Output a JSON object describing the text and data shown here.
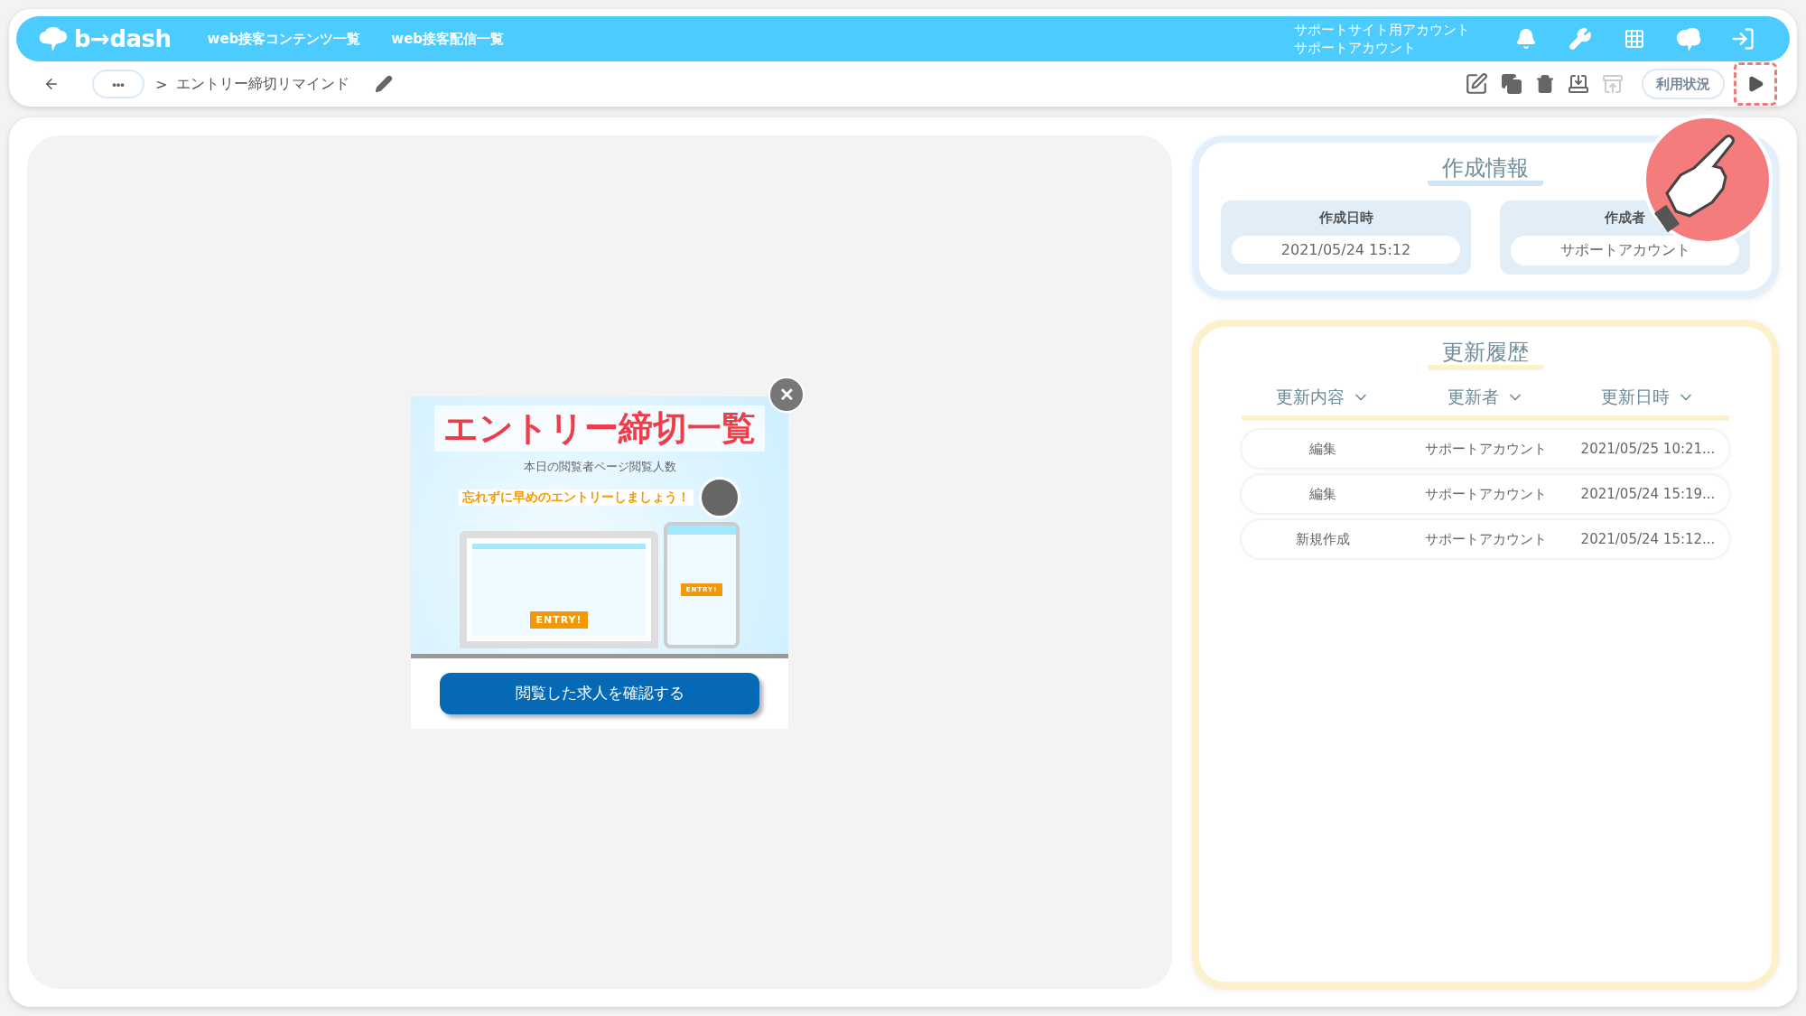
{
  "header": {
    "logo": "b→dash",
    "nav": [
      "web接客コンテンツ一覧",
      "web接客配信一覧"
    ],
    "account": {
      "site": "サポートサイト用アカウント",
      "user": "サポートアカウント"
    }
  },
  "toolbar": {
    "more": "•••",
    "separator": ">",
    "title": "エントリー締切リマインド",
    "usage_button": "利用状況",
    "preview_highlighted": true
  },
  "preview": {
    "headline": "エントリー締切一覧",
    "subtitle": "本日の閲覧者ページ閲覧人数",
    "notice": "忘れずに早めのエントリーしましょう！",
    "entry_labels": [
      "ENTRY!",
      "ENTRY!"
    ],
    "cta": "閲覧した求人を確認する",
    "close": "✕"
  },
  "creation_info": {
    "title": "作成情報",
    "fields": [
      {
        "label": "作成日時",
        "value": "2021/05/24 15:12"
      },
      {
        "label": "作成者",
        "value": "サポートアカウント"
      }
    ]
  },
  "history": {
    "title": "更新履歴",
    "columns": [
      "更新内容",
      "更新者",
      "更新日時"
    ],
    "rows": [
      [
        "編集",
        "サポートアカウント",
        "2021/05/25 10:21..."
      ],
      [
        "編集",
        "サポートアカウント",
        "2021/05/24 15:19..."
      ],
      [
        "新規作成",
        "サポートアカウント",
        "2021/05/24 15:12..."
      ]
    ]
  }
}
